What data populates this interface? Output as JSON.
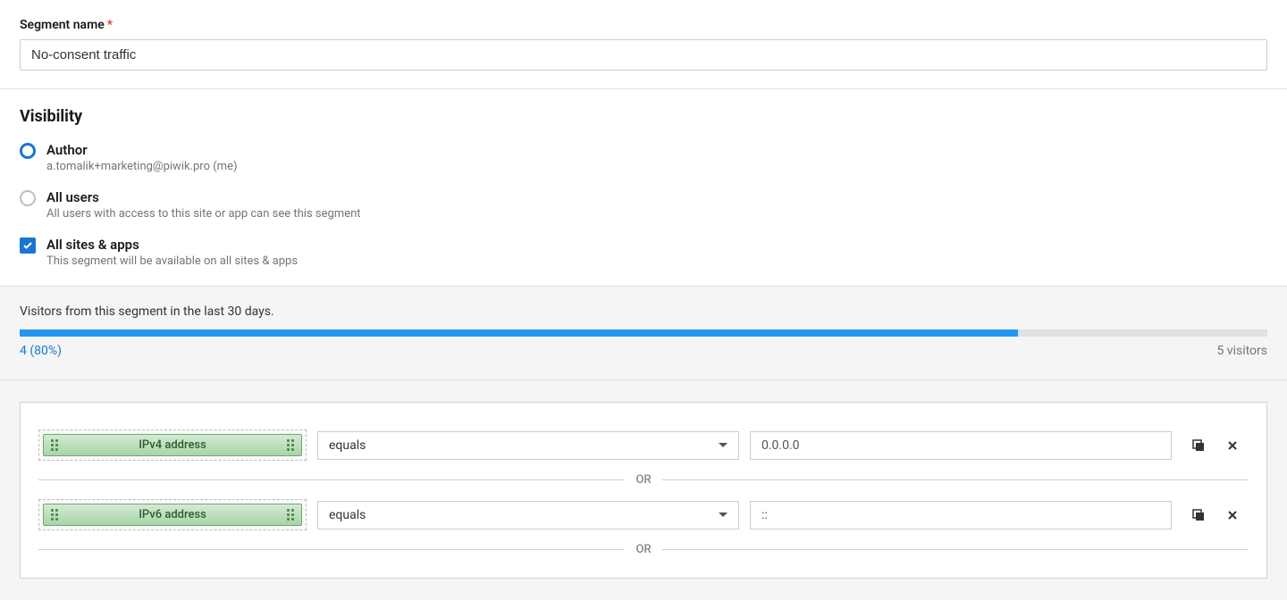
{
  "segmentName": {
    "label": "Segment name",
    "value": "No-consent traffic"
  },
  "visibility": {
    "heading": "Visibility",
    "options": {
      "author": {
        "title": "Author",
        "sub": "a.tomalik+marketing@piwik.pro (me)"
      },
      "allUsers": {
        "title": "All users",
        "sub": "All users with access to this site or app can see this segment"
      },
      "allSites": {
        "title": "All sites & apps",
        "sub": "This segment will be available on all sites & apps"
      }
    }
  },
  "stats": {
    "label": "Visitors from this segment in the last 30 days.",
    "matched": "4 (80%)",
    "total": "5 visitors",
    "fillPercent": 80
  },
  "conditions": {
    "orLabel": "OR",
    "rows": [
      {
        "dimension": "IPv4 address",
        "operator": "equals",
        "value": "0.0.0.0"
      },
      {
        "dimension": "IPv6 address",
        "operator": "equals",
        "value": "::"
      }
    ]
  }
}
